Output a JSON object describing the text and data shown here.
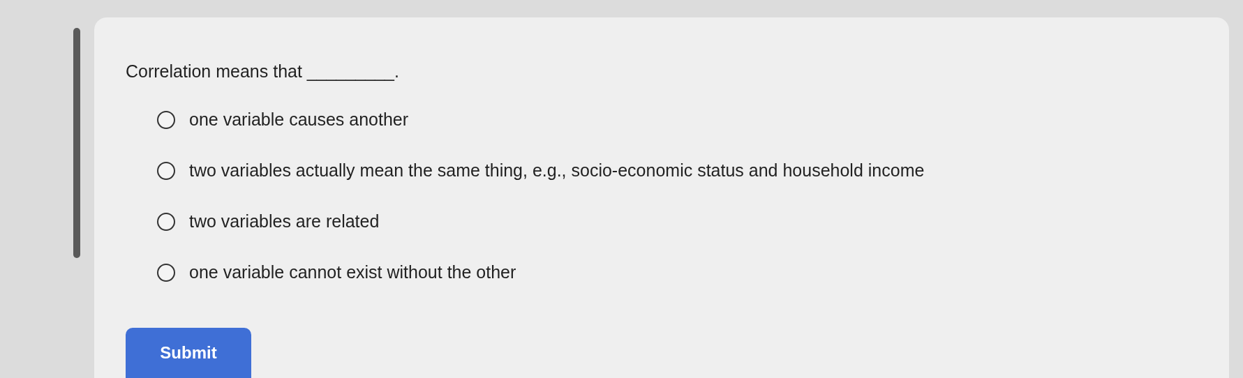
{
  "question": {
    "prompt": "Correlation means that _________."
  },
  "options": [
    {
      "label": "one variable causes another",
      "selected": false
    },
    {
      "label": "two variables actually mean the same thing, e.g., socio-economic status and household income",
      "selected": false
    },
    {
      "label": "two variables are related",
      "selected": false
    },
    {
      "label": "one variable cannot exist without the other",
      "selected": false
    }
  ],
  "submit_button": {
    "label": "Submit"
  }
}
